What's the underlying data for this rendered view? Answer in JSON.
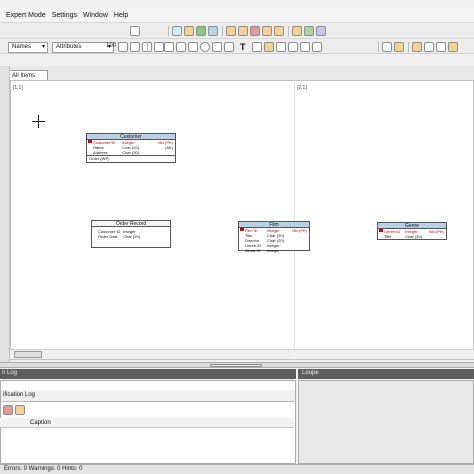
{
  "menu": {
    "items": [
      "Expert Mode",
      "Settings",
      "Window",
      "Help"
    ]
  },
  "toolbar": {
    "names_select": "Names",
    "attributes_select": "Attributes",
    "zoom_value": "100"
  },
  "tabs": {
    "all_items": "All Items"
  },
  "canvas": {
    "page_label_1": "[1,1]",
    "page_label_2": "[2,1]"
  },
  "entities": {
    "customer": {
      "title": "Customer",
      "rows": [
        {
          "name": "Customer ID",
          "type": "Integer",
          "extra": "NN (PK)",
          "pk": true
        },
        {
          "name": "Name",
          "type": "Char (20)",
          "extra": "(AK)",
          "pk": false
        },
        {
          "name": "Address",
          "type": "Char (30)",
          "extra": "",
          "pk": false
        },
        {
          "name": "Order (WP)",
          "type": "",
          "extra": "",
          "pk": false
        }
      ]
    },
    "order_record": {
      "title": "Order Record",
      "rows": [
        {
          "name": "Customer ID",
          "type": "Integer",
          "extra": "",
          "pk": false
        },
        {
          "name": "Order Date",
          "type": "Char (20)",
          "extra": "",
          "pk": false
        }
      ]
    },
    "film": {
      "title": "Film",
      "rows": [
        {
          "name": "Film ID",
          "type": "Integer",
          "extra": "NN (PK)",
          "pk": true
        },
        {
          "name": "Title",
          "type": "Char (20)",
          "extra": "",
          "pk": false
        },
        {
          "name": "Director",
          "type": "Char (20)",
          "extra": "",
          "pk": false
        },
        {
          "name": "Genre ID",
          "type": "Integer",
          "extra": "",
          "pk": false
        },
        {
          "name": "Serial ID",
          "type": "Integer",
          "extra": "",
          "pk": false
        }
      ]
    },
    "genre": {
      "title": "Genre",
      "rows": [
        {
          "name": "Genre ID",
          "type": "Integer",
          "extra": "NN (PK)",
          "pk": true
        },
        {
          "name": "Title",
          "type": "Char (20)",
          "extra": "",
          "pk": false
        }
      ]
    }
  },
  "panels": {
    "left_title": "n Log",
    "left_tab": "ification Log",
    "right_title": "Loupe",
    "caption_header": "Caption"
  },
  "status": {
    "text": "Errors: 0  Warnings: 0  Hints: 0"
  }
}
